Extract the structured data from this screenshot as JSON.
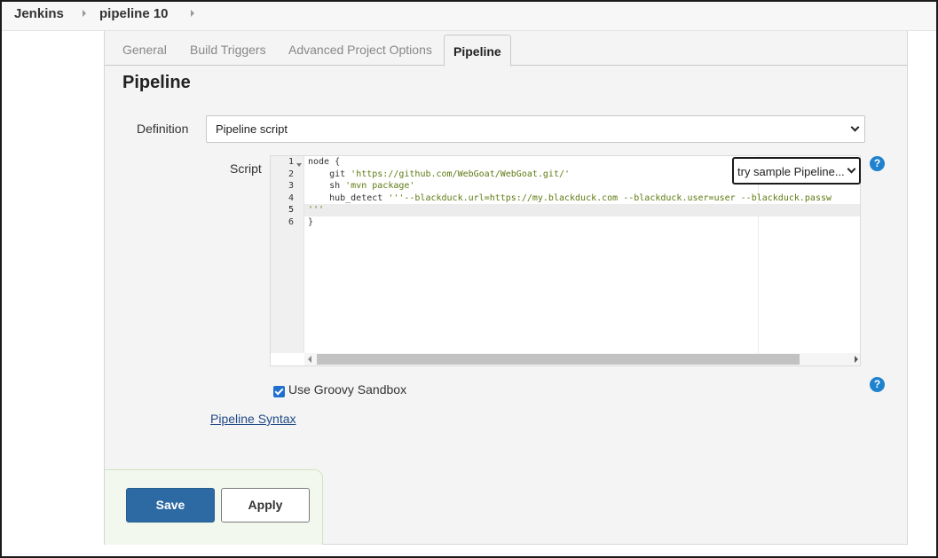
{
  "breadcrumb": {
    "items": [
      "Jenkins",
      "pipeline 10"
    ]
  },
  "tabs": [
    {
      "label": "General",
      "active": false
    },
    {
      "label": "Build Triggers",
      "active": false
    },
    {
      "label": "Advanced Project Options",
      "active": false
    },
    {
      "label": "Pipeline",
      "active": true
    }
  ],
  "section": {
    "title": "Pipeline"
  },
  "definition": {
    "label": "Definition",
    "selected": "Pipeline script"
  },
  "script": {
    "label": "Script",
    "sample_select": "try sample Pipeline...",
    "lines": [
      {
        "num": "1",
        "code": "node {"
      },
      {
        "num": "2",
        "code": "    git ",
        "str": "'https://github.com/WebGoat/WebGoat.git/'"
      },
      {
        "num": "3",
        "code": "    sh ",
        "str": "'mvn package'"
      },
      {
        "num": "4",
        "code": "    hub_detect ",
        "str": "'''--blackduck.url=https://my.blackduck.com --blackduck.user=user --blackduck.passw"
      },
      {
        "num": "5",
        "code": "",
        "str": "'''"
      },
      {
        "num": "6",
        "code": "}"
      }
    ],
    "highlighted_line": "5"
  },
  "sandbox": {
    "label": "Use Groovy Sandbox",
    "checked": true
  },
  "links": {
    "pipeline_syntax": "Pipeline Syntax"
  },
  "help_icon": {
    "glyph": "?"
  },
  "buttons": {
    "save": "Save",
    "apply": "Apply"
  },
  "colors": {
    "primary_button": "#2d6aa3",
    "help_icon": "#1e82cf",
    "string_literal": "#5e7a12",
    "checkbox": "#1f6fd1"
  }
}
